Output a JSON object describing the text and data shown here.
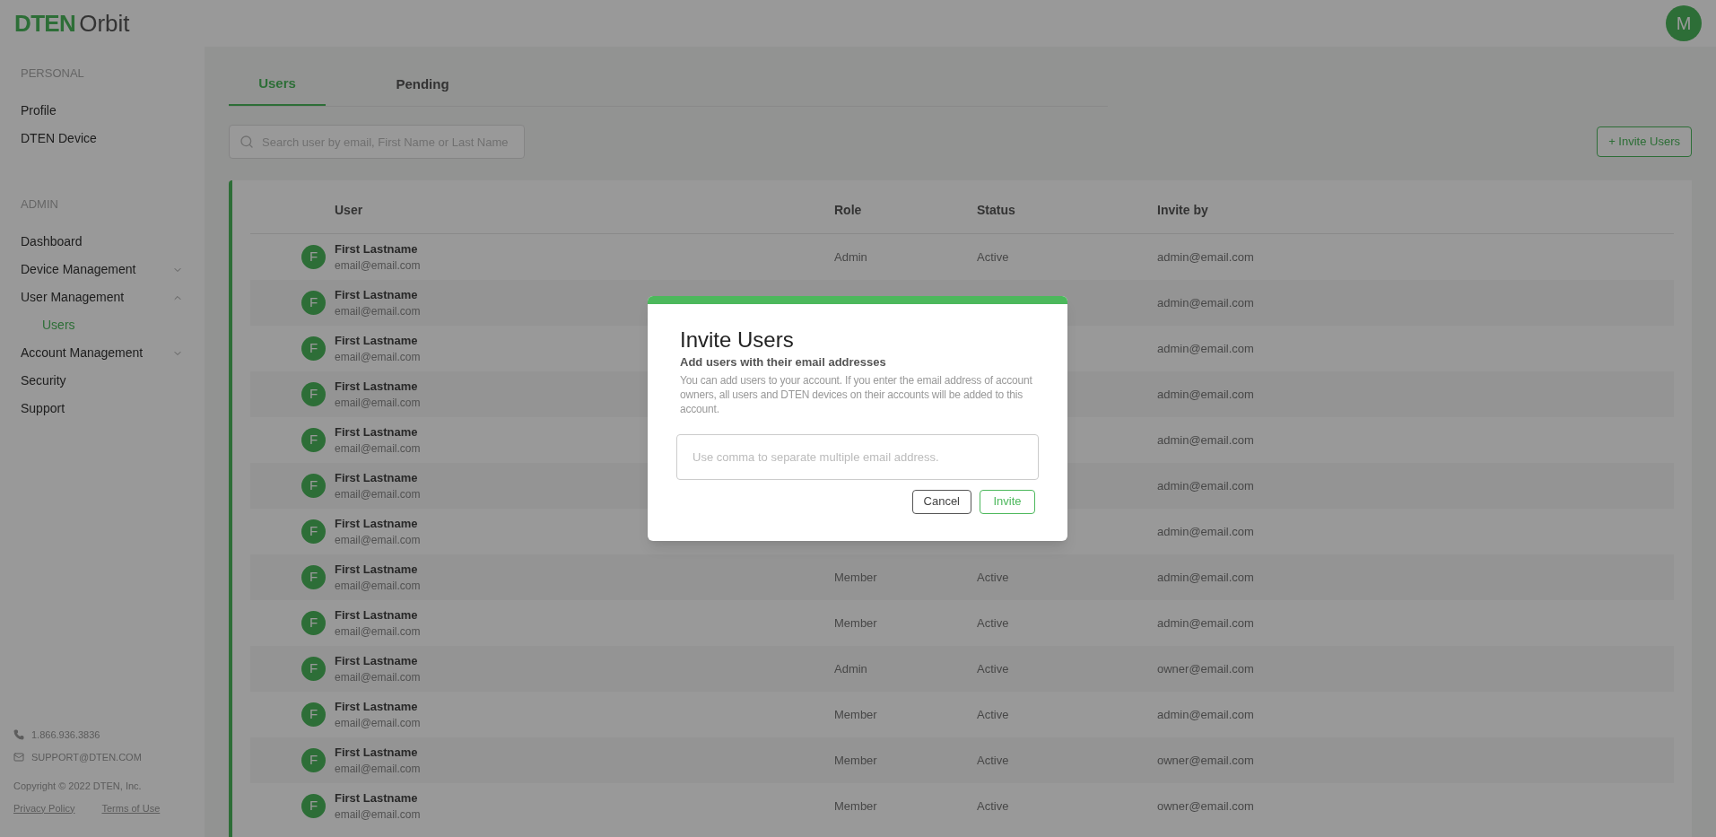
{
  "header": {
    "logo_bold": "DTEN",
    "logo_light": "Orbit",
    "avatar": "M"
  },
  "sidebar": {
    "sections": [
      {
        "title": "PERSONAL",
        "items": [
          {
            "label": "Profile",
            "selected": false
          },
          {
            "label": "DTEN Device",
            "selected": false
          }
        ]
      },
      {
        "title": "ADMIN",
        "items": [
          {
            "label": "Dashboard",
            "selected": false
          },
          {
            "label": "Device Management",
            "selected": false,
            "expanded": false
          },
          {
            "label": "User Management",
            "selected": false,
            "expanded": true,
            "children": [
              {
                "label": "Users",
                "selected": true
              }
            ]
          },
          {
            "label": "Account Management",
            "selected": false,
            "expanded": false
          },
          {
            "label": "Security",
            "selected": false
          },
          {
            "label": "Support",
            "selected": false
          }
        ]
      }
    ],
    "phone": "1.866.936.3836",
    "email": "SUPPORT@DTEN.COM",
    "copyright": "Copyright © 2022 DTEN, Inc.",
    "links": [
      "Privacy Policy",
      "Terms of Use"
    ]
  },
  "tabs": [
    {
      "label": "Users",
      "selected": true
    },
    {
      "label": "Pending",
      "selected": false
    }
  ],
  "search": {
    "placeholder": "Search user by email, First Name or Last Name"
  },
  "invite_button": "+ Invite Users",
  "table": {
    "columns": [
      "User",
      "Role",
      "Status",
      "Invite by"
    ],
    "rows": [
      {
        "initial": "F",
        "name": "First Lastname",
        "email": "email@email.com",
        "role": "Admin",
        "status": "Active",
        "invited_by": "admin@email.com"
      },
      {
        "initial": "F",
        "name": "First Lastname",
        "email": "email@email.com",
        "invited_by": "admin@email.com"
      },
      {
        "initial": "F",
        "name": "First Lastname",
        "email": "email@email.com",
        "invited_by": "admin@email.com"
      },
      {
        "initial": "F",
        "name": "First Lastname",
        "email": "email@email.com",
        "invited_by": "admin@email.com"
      },
      {
        "initial": "F",
        "name": "First Lastname",
        "email": "email@email.com",
        "invited_by": "admin@email.com"
      },
      {
        "initial": "F",
        "name": "First Lastname",
        "email": "email@email.com",
        "invited_by": "admin@email.com"
      },
      {
        "initial": "F",
        "name": "First Lastname",
        "email": "email@email.com",
        "invited_by": "admin@email.com"
      },
      {
        "initial": "F",
        "name": "First Lastname",
        "email": "email@email.com",
        "role": "Member",
        "status": "Active",
        "invited_by": "admin@email.com"
      },
      {
        "initial": "F",
        "name": "First Lastname",
        "email": "email@email.com",
        "role": "Member",
        "status": "Active",
        "invited_by": "admin@email.com"
      },
      {
        "initial": "F",
        "name": "First Lastname",
        "email": "email@email.com",
        "role": "Admin",
        "status": "Active",
        "invited_by": "owner@email.com"
      },
      {
        "initial": "F",
        "name": "First Lastname",
        "email": "email@email.com",
        "role": "Member",
        "status": "Active",
        "invited_by": "admin@email.com"
      },
      {
        "initial": "F",
        "name": "First Lastname",
        "email": "email@email.com",
        "role": "Member",
        "status": "Active",
        "invited_by": "owner@email.com"
      },
      {
        "initial": "F",
        "name": "First Lastname",
        "email": "email@email.com",
        "role": "Member",
        "status": "Active",
        "invited_by": "owner@email.com"
      }
    ]
  },
  "dialog": {
    "title": "Invite Users",
    "subtitle": "Add users with their email addresses",
    "description": "You can add users to your account. If you enter the email address of account owners, all users and DTEN devices on their accounts will be added to this account.",
    "placeholder": "Use comma to separate multiple email address.",
    "buttons": [
      "Cancel",
      "Invite"
    ]
  }
}
